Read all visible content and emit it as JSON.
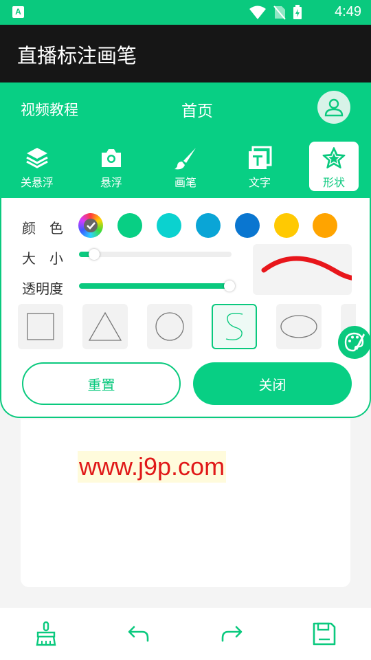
{
  "status_bar": {
    "time": "4:49",
    "app_icon_letter": "A"
  },
  "app": {
    "title": "直播标注画笔"
  },
  "nav": {
    "tutorial": "视频教程",
    "home": "首页"
  },
  "toolbar": {
    "items": [
      {
        "label": "关悬浮",
        "icon": "layers-icon",
        "active": false
      },
      {
        "label": "悬浮",
        "icon": "camera-icon",
        "active": false
      },
      {
        "label": "画笔",
        "icon": "brush-icon",
        "active": false
      },
      {
        "label": "文字",
        "icon": "text-icon",
        "active": false
      },
      {
        "label": "形状",
        "icon": "star-icon",
        "active": true
      }
    ]
  },
  "panel": {
    "color_label": "颜　色",
    "size_label": "大　小",
    "opacity_label": "透明度",
    "colors": [
      "#08cf84",
      "#0bd2cf",
      "#0aa5d6",
      "#0a76d0",
      "#ffc902",
      "#ffa400"
    ],
    "size_value": 0.1,
    "opacity_value": 0.97,
    "preview_stroke_color": "#e8161b",
    "shapes": [
      "square",
      "triangle",
      "circle",
      "freehand",
      "ellipse"
    ],
    "selected_shape": "freehand",
    "reset_label": "重置",
    "close_label": "关闭"
  },
  "canvas": {
    "watermark": "www.j9p.com"
  },
  "bottom_bar": [
    "broom-icon",
    "undo-icon",
    "redo-icon",
    "save-icon"
  ],
  "accent": "#0ac97e"
}
